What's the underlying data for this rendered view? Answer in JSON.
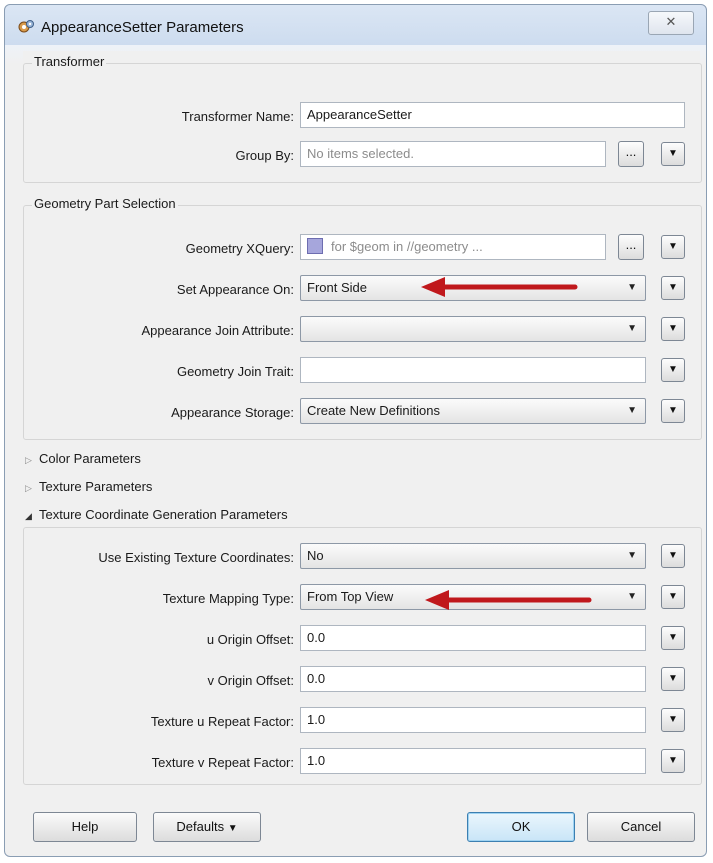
{
  "window": {
    "title": "AppearanceSetter Parameters",
    "close_glyph": "✕"
  },
  "transformer": {
    "group_title": "Transformer",
    "name_label": "Transformer Name:",
    "name_value": "AppearanceSetter",
    "groupby_label": "Group By:",
    "groupby_placeholder": "No items selected.",
    "dots": "..."
  },
  "geometry": {
    "group_title": "Geometry Part Selection",
    "xquery_label": "Geometry XQuery:",
    "xquery_value": "for $geom in //geometry ...",
    "set_appearance_label": "Set Appearance On:",
    "set_appearance_value": "Front Side",
    "join_attr_label": "Appearance Join Attribute:",
    "join_attr_value": "",
    "join_trait_label": "Geometry Join Trait:",
    "join_trait_value": "",
    "storage_label": "Appearance Storage:",
    "storage_value": "Create New Definitions"
  },
  "collapsed": {
    "color": "Color Parameters",
    "texture": "Texture Parameters",
    "texcoord": "Texture Coordinate Generation Parameters"
  },
  "texcoord": {
    "use_existing_label": "Use Existing Texture Coordinates:",
    "use_existing_value": "No",
    "mapping_label": "Texture Mapping Type:",
    "mapping_value": "From Top View",
    "u_origin_label": "u Origin Offset:",
    "u_origin_value": "0.0",
    "v_origin_label": "v Origin Offset:",
    "v_origin_value": "0.0",
    "u_repeat_label": "Texture u Repeat Factor:",
    "u_repeat_value": "1.0",
    "v_repeat_label": "Texture v Repeat Factor:",
    "v_repeat_value": "1.0"
  },
  "buttons": {
    "help": "Help",
    "defaults": "Defaults",
    "ok": "OK",
    "cancel": "Cancel"
  },
  "icons": {
    "window": "transformer-gear-icon",
    "dropdown": "chevron-down-icon",
    "menu": "menu-triangle-icon",
    "arrow": "red-annotation-arrow"
  },
  "colors": {
    "annotation_arrow": "#c0181c",
    "xquery_swatch": "#a6a6dc"
  }
}
